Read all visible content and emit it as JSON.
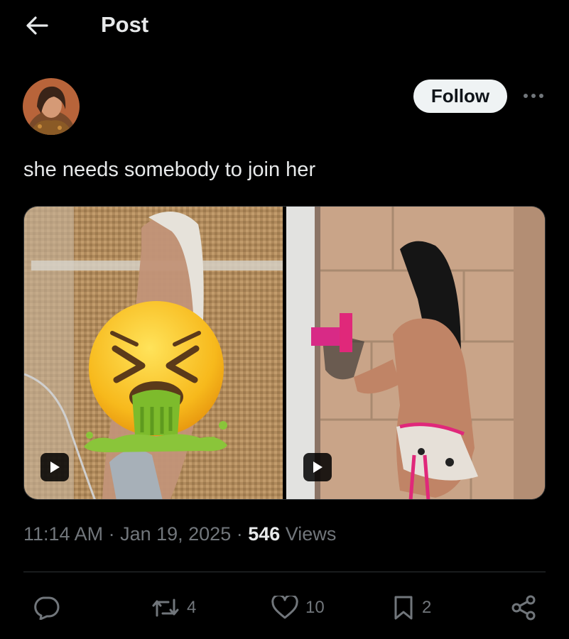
{
  "header": {
    "title": "Post",
    "back_icon": "arrow-left-icon"
  },
  "post": {
    "follow_label": "Follow",
    "more_icon": "more-horizontal-icon",
    "text": "she needs somebody to join her",
    "media": [
      {
        "type": "video",
        "overlay_icon": "vomiting-face-emoji"
      },
      {
        "type": "video"
      }
    ],
    "time": "11:14 AM",
    "sep1": " · ",
    "date": "Jan 19, 2025",
    "sep2": " · ",
    "views_count": "546",
    "views_label": " Views"
  },
  "actions": {
    "reply_count": "",
    "repost_count": "4",
    "like_count": "10",
    "bookmark_count": "2"
  },
  "colors": {
    "background": "#000000",
    "text_primary": "#e7e9ea",
    "text_secondary": "#71767b",
    "follow_bg": "#eff3f4",
    "divider": "#2f3336"
  }
}
